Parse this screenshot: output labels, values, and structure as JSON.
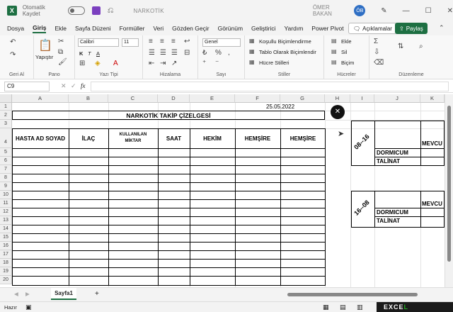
{
  "window": {
    "autosave_label": "Otomatik Kaydet",
    "title": "NARKOTİK",
    "user": "ÖMER BAKAN",
    "avatar_initials": "ÖB"
  },
  "menu": {
    "tabs": [
      "Dosya",
      "Giriş",
      "Ekle",
      "Sayfa Düzeni",
      "Formüller",
      "Veri",
      "Gözden Geçir",
      "Görünüm",
      "Geliştirici",
      "Yardım",
      "Power Pivot"
    ],
    "active": "Giriş",
    "comments_label": "Açıklamalar",
    "share_label": "Paylaş"
  },
  "ribbon": {
    "groups": {
      "undo": "Geri Al",
      "clipboard": "Pano",
      "font": "Yazı Tipi",
      "alignment": "Hizalama",
      "number": "Sayı",
      "styles": "Stiller",
      "cells": "Hücreler",
      "editing": "Düzenleme"
    },
    "paste_label": "Yapıştır",
    "font_name": "Calibri",
    "font_size": "11",
    "number_format": "Genel",
    "conditional": "Koşullu Biçimlendirme",
    "format_table": "Tablo Olarak Biçimlendir",
    "cell_styles": "Hücre Stilleri",
    "insert": "Ekle",
    "delete": "Sil",
    "format": "Biçim"
  },
  "formula": {
    "name_box": "C9",
    "fx": "fx",
    "value": ""
  },
  "grid": {
    "columns": [
      "A",
      "B",
      "C",
      "D",
      "E",
      "F",
      "G",
      "H",
      "I",
      "J",
      "K"
    ],
    "rows": [
      "1",
      "2",
      "3",
      "4",
      "5",
      "6",
      "7",
      "8",
      "9",
      "10",
      "11",
      "12",
      "13",
      "14",
      "15",
      "16",
      "17",
      "18",
      "19",
      "20"
    ],
    "date": "25.05.2022",
    "title": "NARKOTİK TAKİP ÇİZELGESİ",
    "headers": {
      "patient": "HASTA AD SOYAD",
      "drug": "İLAÇ",
      "used_line1": "KULLANILAN",
      "used_line2": "MİKTAR",
      "time": "SAAT",
      "doctor": "HEKİM",
      "nurse1": "HEMŞİRE",
      "nurse2": "HEMŞİRE"
    },
    "side_table_1": {
      "shift": "08--16",
      "col": "MEVCU",
      "rows": [
        "DORMICUM",
        "TALİNAT"
      ]
    },
    "side_table_2": {
      "shift": "16--08",
      "col": "MEVCU",
      "rows": [
        "DORMICUM",
        "TALİNAT"
      ]
    }
  },
  "sheets": {
    "tabs": [
      "Sayfa1"
    ],
    "add": "+"
  },
  "status": {
    "mode": "Hazır"
  },
  "branding": {
    "logo_text_white": "EXCE",
    "logo_text_green": "L"
  }
}
